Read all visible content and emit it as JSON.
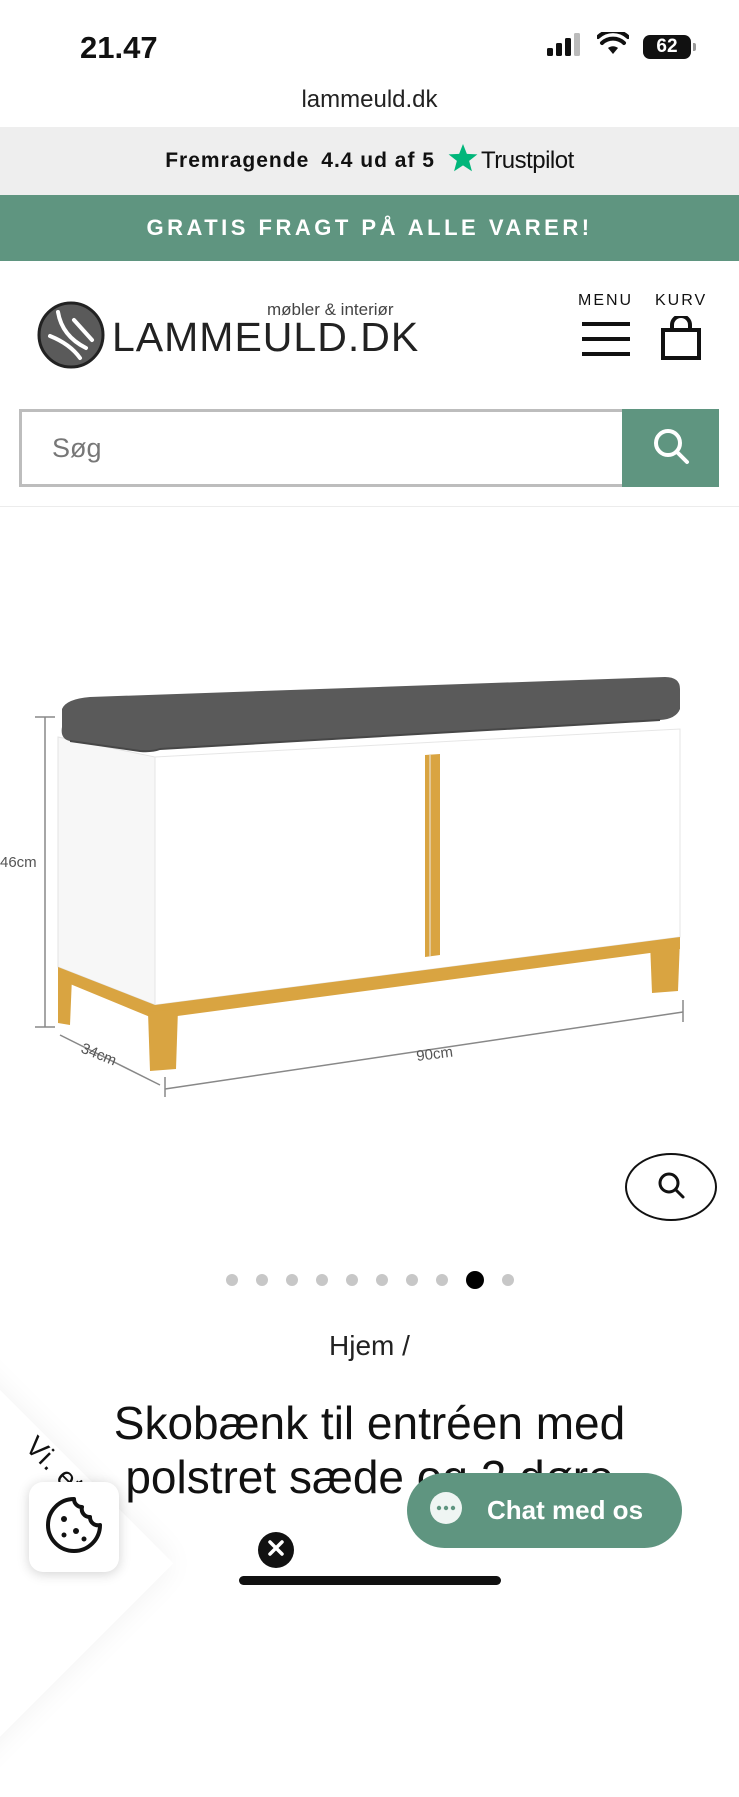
{
  "status_bar": {
    "time": "21.47",
    "battery": "62"
  },
  "browser": {
    "url": "lammeuld.dk"
  },
  "rating_bar": {
    "label": "Fremragende",
    "score": "4.4 ud af 5",
    "brand": "Trustpilot"
  },
  "promo": {
    "text": "GRATIS FRAGT PÅ ALLE VARER!"
  },
  "header": {
    "logo_text": "LAMMEULD.DK",
    "logo_tagline": "møbler & interiør",
    "menu_label": "MENU",
    "cart_label": "KURV"
  },
  "search": {
    "placeholder": "Søg"
  },
  "gallery": {
    "dimension_height": "46cm",
    "dimension_depth": "34cm",
    "dimension_width": "90cm",
    "dots_count": 10,
    "active_dot": 9
  },
  "breadcrumb": {
    "text": "Hjem /"
  },
  "product": {
    "title": "Skobænk til entréen med polstret sæde og 2 døre"
  },
  "cookie": {
    "label": "Vi. et"
  },
  "chat": {
    "label": "Chat med os"
  },
  "colors": {
    "accent": "#5f9580",
    "star": "#00b67a",
    "cushion": "#5a5a5a",
    "wood": "#d9a441"
  },
  "icons": [
    "signal-icon",
    "wifi-icon",
    "battery-icon",
    "star-icon",
    "hamburger-icon",
    "bag-icon",
    "search-icon",
    "cookie-icon",
    "close-icon",
    "chat-icon"
  ]
}
